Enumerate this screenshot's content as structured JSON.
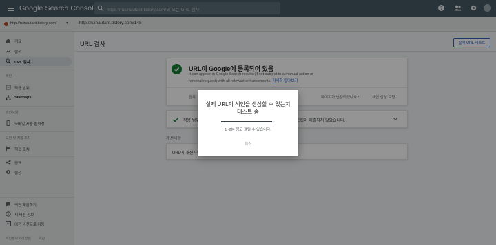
{
  "app": {
    "title": "Google Search Console"
  },
  "search": {
    "placeholder": "https://rusinautant.tistory.com/의 모든 URL 검사"
  },
  "property": {
    "name": "http://ruinautant.tistory.com/"
  },
  "inspected_url": "http://ruinautant.tistory.com/148",
  "sidebar": {
    "items_top": [
      {
        "label": "개요",
        "icon": "home-icon"
      },
      {
        "label": "실적",
        "icon": "trend-icon"
      },
      {
        "label": "URL 검사",
        "icon": "search-icon",
        "active": true
      }
    ],
    "section_index": "색인",
    "items_index": [
      {
        "label": "적용 범위",
        "icon": "coverage-icon"
      },
      {
        "label": "Sitemaps",
        "icon": "sitemap-icon"
      }
    ],
    "section_enhancements": "개선사항",
    "items_enhancements": [
      {
        "label": "모바일 사용 편의성",
        "icon": "mobile-icon"
      }
    ],
    "section_security": "보안 및 직접 조치",
    "items_security": [
      {
        "label": "직접 조치",
        "icon": "flag-icon"
      }
    ],
    "items_more": [
      {
        "label": "링크",
        "icon": "links-icon"
      },
      {
        "label": "설정",
        "icon": "gear-icon"
      }
    ],
    "items_bottom": [
      {
        "label": "의견 제출하기",
        "icon": "feedback-icon"
      },
      {
        "label": "새 버전 정보",
        "icon": "info-icon"
      },
      {
        "label": "이전 버전으로 이동",
        "icon": "back-icon"
      }
    ],
    "footer": {
      "privacy": "개인정보처리방침",
      "terms": "약관"
    }
  },
  "main": {
    "title": "URL 검사",
    "live_test_button": "실제 URL 테스트",
    "status_card": {
      "title": "URL이 Google에 등록되어 있음",
      "subtitle_line1": "It can appear in Google Search results (if not subject to a manual action or",
      "subtitle_line2": "removal request) with all relevant enhancements.",
      "subtitle_link": "자세히 알아보기",
      "action_1": "등록",
      "action_2": "페이지가 변경되었나요?",
      "action_3": "색인 생성 요청"
    },
    "coverage_card": {
      "text_left": "적용 범위",
      "text_right": "트립이 제출되지 않았습니다."
    },
    "enhancements_label": "개선사항",
    "enhancement_card": {
      "text": "URL에 개선사항"
    }
  },
  "dialog": {
    "title": "실제 URL의 색인을 생성할 수 있는지 테스트 중",
    "progress": 0.95,
    "time_text": "1~2분 정도 걸릴 수 있습니다.",
    "cancel_label": "취소"
  },
  "colors": {
    "topbar": "#455a64",
    "success": "#188038",
    "link": "#1a56c4"
  }
}
